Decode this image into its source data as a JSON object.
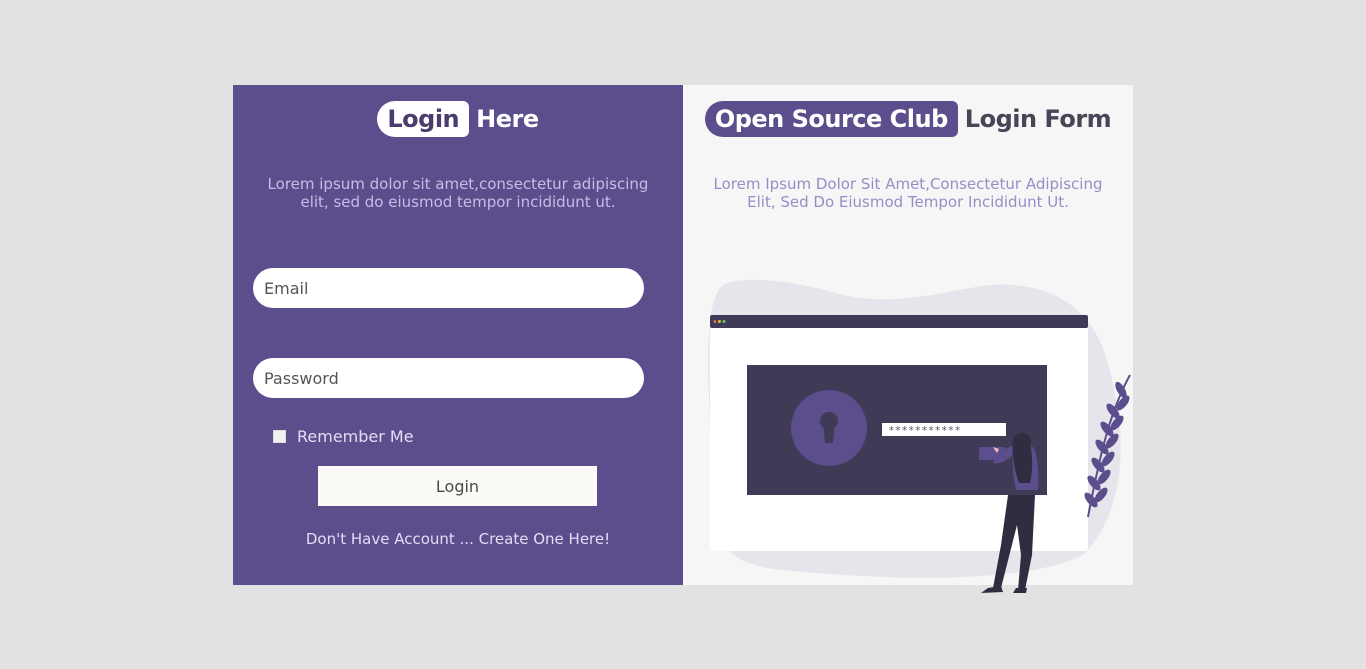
{
  "left": {
    "title_pill": "Login",
    "title_tail": "Here",
    "description": "Lorem ipsum dolor sit amet,consectetur adipiscing elit, sed do eiusmod tempor incididunt ut.",
    "email_placeholder": "Email",
    "password_placeholder": "Password",
    "remember_label": "Remember Me",
    "login_button": "Login",
    "signup_text": "Don't Have Account ... Create One Here!"
  },
  "right": {
    "title_pill": "Open Source Club",
    "title_tail": "Login Form",
    "description": "Lorem Ipsum Dolor Sit Amet,Consectetur Adipiscing Elit, Sed Do Eiusmod Tempor Incididunt Ut.",
    "illustration_password": "***********"
  },
  "colors": {
    "panel_purple": "#5c4e8c",
    "panel_light": "#f6f6f6",
    "page_bg": "#e2e2e2",
    "illustration_dark": "#3f3a56"
  }
}
